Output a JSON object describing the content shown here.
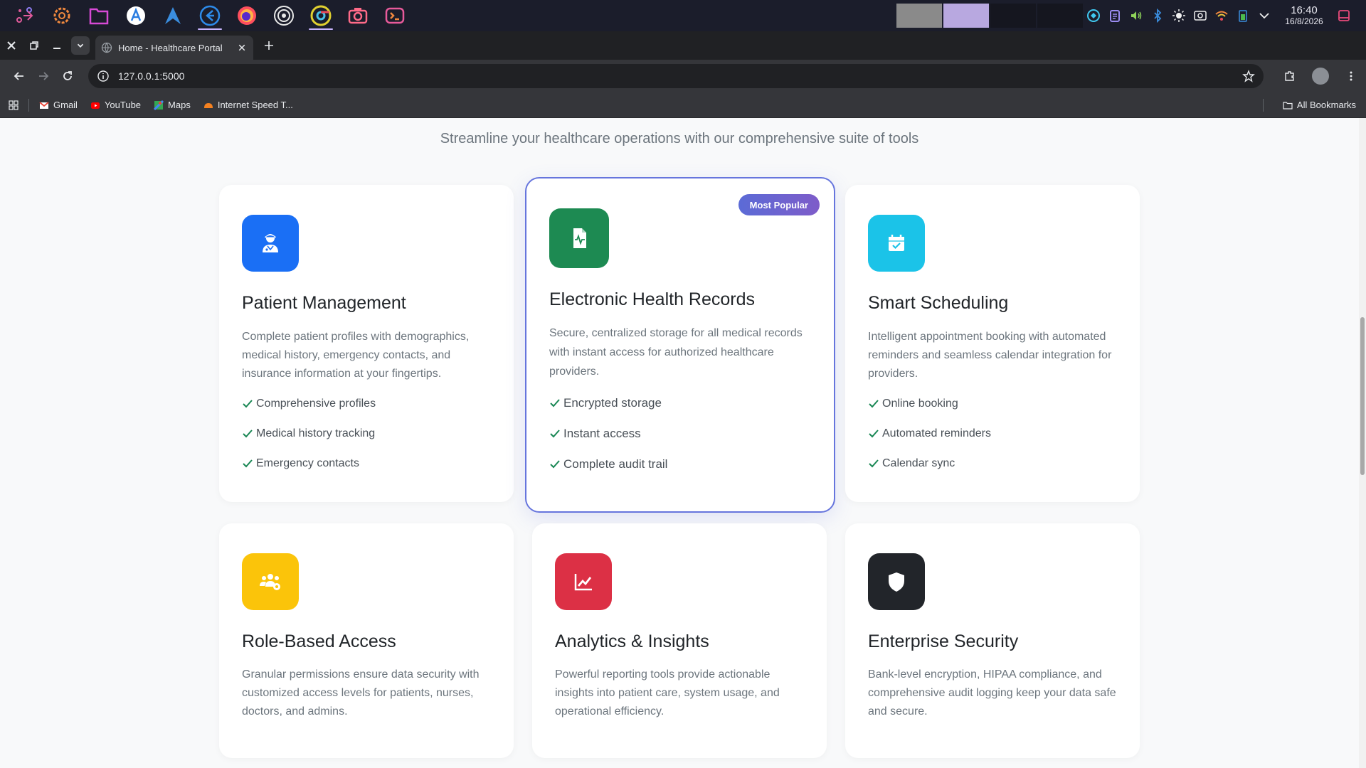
{
  "taskbar": {
    "apps": [
      {
        "name": "launcher-icon",
        "color": "#e05a9a"
      },
      {
        "name": "settings-icon",
        "color": "#f0883e"
      },
      {
        "name": "files-icon",
        "color": "#d74ad6"
      },
      {
        "name": "app-store-icon",
        "color": "#2a7de1"
      },
      {
        "name": "arch-icon",
        "color": "#3a8dde"
      },
      {
        "name": "vscode-icon",
        "color": "#2d8ae8"
      },
      {
        "name": "firefox-icon",
        "color": "#ff4f5e"
      },
      {
        "name": "obs-icon",
        "color": "#e8e8e8"
      },
      {
        "name": "chrome-icon",
        "color": "#e0d030"
      },
      {
        "name": "screenshot-icon",
        "color": "#ff6a88"
      },
      {
        "name": "terminal-icon",
        "color": "#e85a9b"
      }
    ],
    "window_thumbs": [
      "#8a8a8a",
      "#b8a8e0",
      "#15161f",
      "#15161f"
    ],
    "clock": {
      "time": "16:40",
      "date": "16/8/2026"
    }
  },
  "browser": {
    "tab_title": "Home - Healthcare Portal",
    "url": "127.0.0.1:5000",
    "bookmarks": [
      {
        "label": "Gmail",
        "icon": "gmail-icon",
        "color": "#ea4335"
      },
      {
        "label": "YouTube",
        "icon": "youtube-icon",
        "color": "#ff0000"
      },
      {
        "label": "Maps",
        "icon": "maps-icon",
        "color": "#34a853"
      },
      {
        "label": "Internet Speed T...",
        "icon": "speedtest-icon",
        "color": "#f48120"
      }
    ],
    "all_bookmarks": "All Bookmarks"
  },
  "page": {
    "subtitle": "Streamline your healthcare operations with our comprehensive suite of tools",
    "cards": [
      {
        "title": "Patient Management",
        "icon": "doctor-icon",
        "color": "#1a6ff5",
        "desc": "Complete patient profiles with demographics, medical history, emergency contacts, and insurance information at your fingertips.",
        "features": [
          "Comprehensive profiles",
          "Medical history tracking",
          "Emergency contacts"
        ]
      },
      {
        "title": "Electronic Health Records",
        "icon": "medical-file-icon",
        "color": "#1d8a52",
        "badge": "Most Popular",
        "desc": "Secure, centralized storage for all medical records with instant access for authorized healthcare providers.",
        "features": [
          "Encrypted storage",
          "Instant access",
          "Complete audit trail"
        ]
      },
      {
        "title": "Smart Scheduling",
        "icon": "calendar-check-icon",
        "color": "#1bc3e8",
        "desc": "Intelligent appointment booking with automated reminders and seamless calendar integration for providers.",
        "features": [
          "Online booking",
          "Automated reminders",
          "Calendar sync"
        ]
      },
      {
        "title": "Role-Based Access",
        "icon": "users-gear-icon",
        "color": "#fbc40a",
        "desc": "Granular permissions ensure data security with customized access levels for patients, nurses, doctors, and admins."
      },
      {
        "title": "Analytics & Insights",
        "icon": "chart-line-icon",
        "color": "#dc3045",
        "desc": "Powerful reporting tools provide actionable insights into patient care, system usage, and operational efficiency."
      },
      {
        "title": "Enterprise Security",
        "icon": "shield-icon",
        "color": "#22252a",
        "desc": "Bank-level encryption, HIPAA compliance, and comprehensive audit logging keep your data safe and secure."
      }
    ]
  }
}
